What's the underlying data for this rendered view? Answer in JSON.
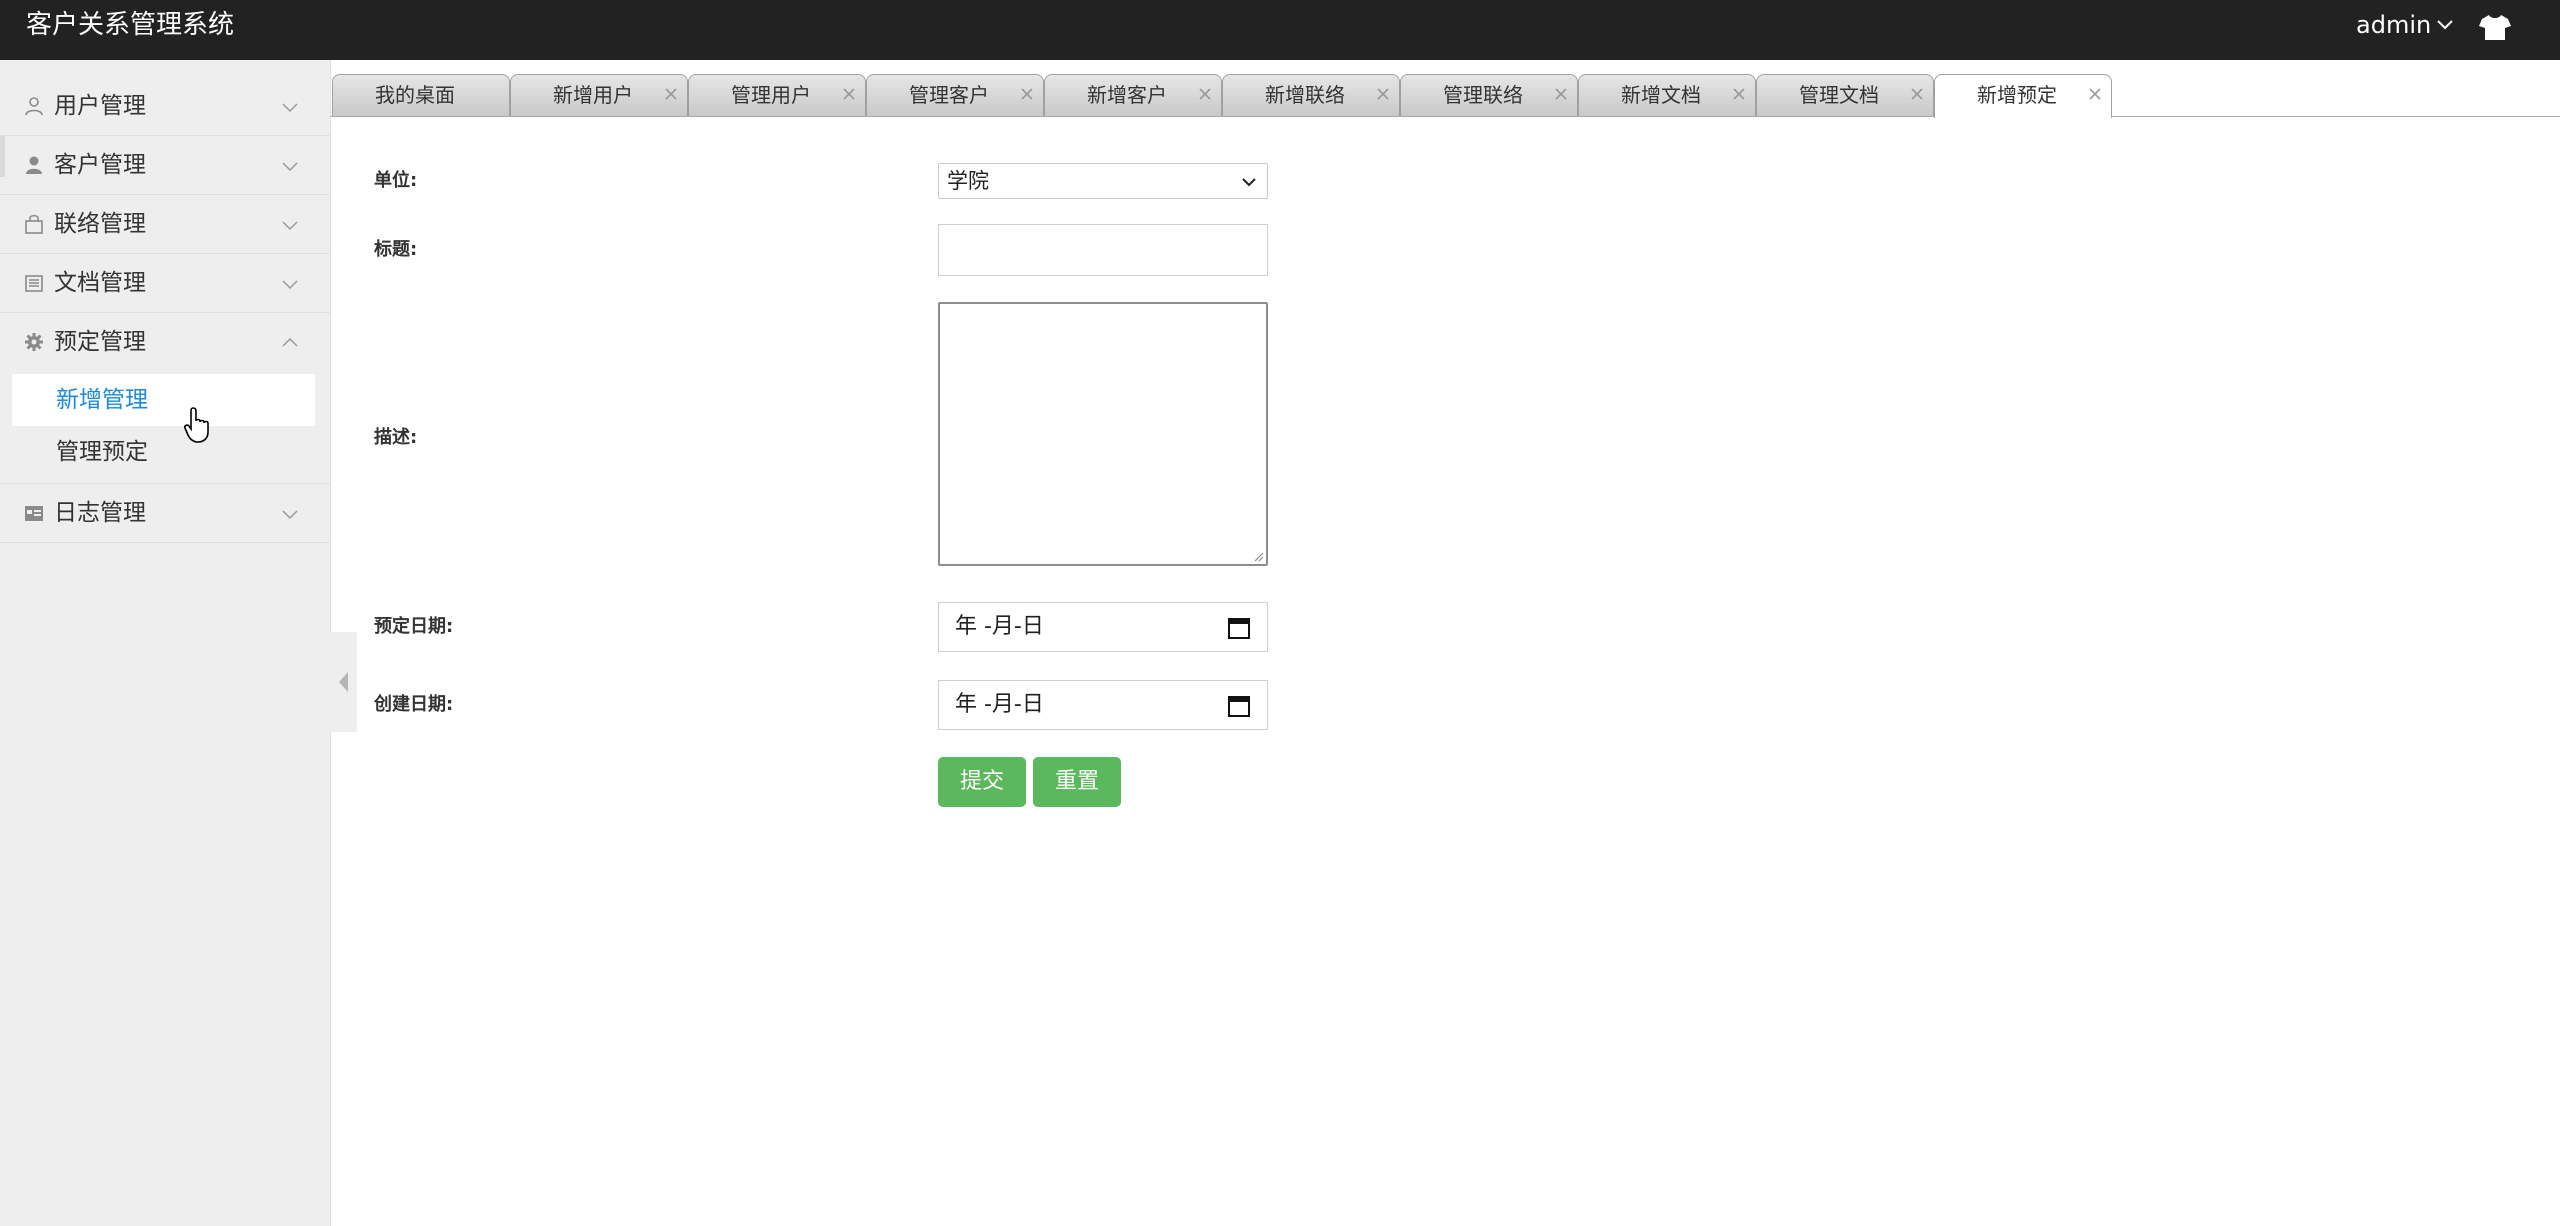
{
  "header": {
    "app_title": "客户关系管理系统",
    "user_name": "admin",
    "theme_icon": "tshirt-icon"
  },
  "sidebar": {
    "items": [
      {
        "label": "用户管理",
        "icon": "user-outline-icon",
        "expanded": false
      },
      {
        "label": "客户管理",
        "icon": "user-solid-icon",
        "expanded": false
      },
      {
        "label": "联络管理",
        "icon": "bag-icon",
        "expanded": false
      },
      {
        "label": "文档管理",
        "icon": "document-icon",
        "expanded": false
      },
      {
        "label": "预定管理",
        "icon": "gear-icon",
        "expanded": true,
        "children": [
          {
            "label": "新增管理",
            "active": true
          },
          {
            "label": "管理预定",
            "active": false
          }
        ]
      },
      {
        "label": "日志管理",
        "icon": "calendar-log-icon",
        "expanded": false
      }
    ]
  },
  "tabs": [
    {
      "label": "我的桌面",
      "closable": false,
      "active": false
    },
    {
      "label": "新增用户",
      "closable": true,
      "active": false
    },
    {
      "label": "管理用户",
      "closable": true,
      "active": false
    },
    {
      "label": "管理客户",
      "closable": true,
      "active": false
    },
    {
      "label": "新增客户",
      "closable": true,
      "active": false
    },
    {
      "label": "新增联络",
      "closable": true,
      "active": false
    },
    {
      "label": "管理联络",
      "closable": true,
      "active": false
    },
    {
      "label": "新增文档",
      "closable": true,
      "active": false
    },
    {
      "label": "管理文档",
      "closable": true,
      "active": false
    },
    {
      "label": "新增预定",
      "closable": true,
      "active": true
    }
  ],
  "form": {
    "unit_label": "单位:",
    "unit_value": "学院",
    "title_label": "标题:",
    "title_value": "",
    "desc_label": "描述:",
    "desc_value": "",
    "reserve_date_label": "预定日期:",
    "reserve_date_placeholder": "年 -月-日",
    "create_date_label": "创建日期:",
    "create_date_placeholder": "年 -月-日",
    "submit_label": "提交",
    "reset_label": "重置"
  },
  "colors": {
    "header_bg": "#222222",
    "sidebar_bg": "#eeeeee",
    "active_link": "#1e88d9",
    "button_green": "#5cb85c"
  }
}
